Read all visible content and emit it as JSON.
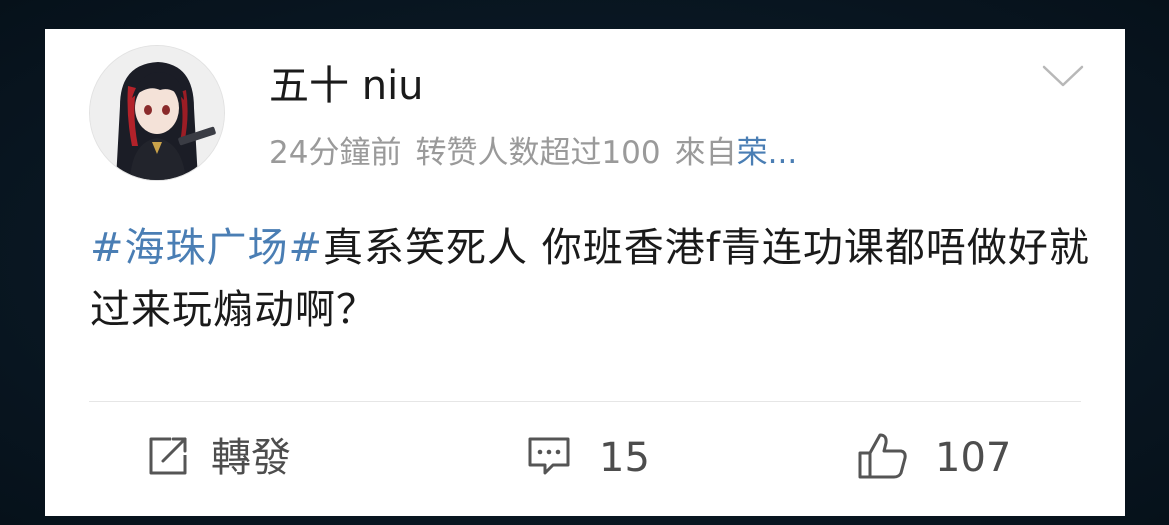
{
  "post": {
    "author": "五十 niu",
    "time_ago": "24分鐘前",
    "popularity": "转赞人数超过100",
    "source_prefix": "來自",
    "source_link": "荣...",
    "hashtag": "#海珠广场#",
    "content": "真系笑死人 你班香港f青连功课都唔做好就过来玩煽动啊？"
  },
  "actions": {
    "repost_label": "轉發",
    "comment_count": "15",
    "like_count": "107"
  },
  "icons": {
    "avatar": "avatar-anime-girl",
    "menu": "chevron-down-icon",
    "repost": "share-icon",
    "comment": "comment-icon",
    "like": "thumbs-up-icon"
  },
  "colors": {
    "background": "#0a1824",
    "card": "#ffffff",
    "link": "#4a7eb4",
    "meta": "#9a9a9a",
    "text": "#1a1a1a"
  }
}
